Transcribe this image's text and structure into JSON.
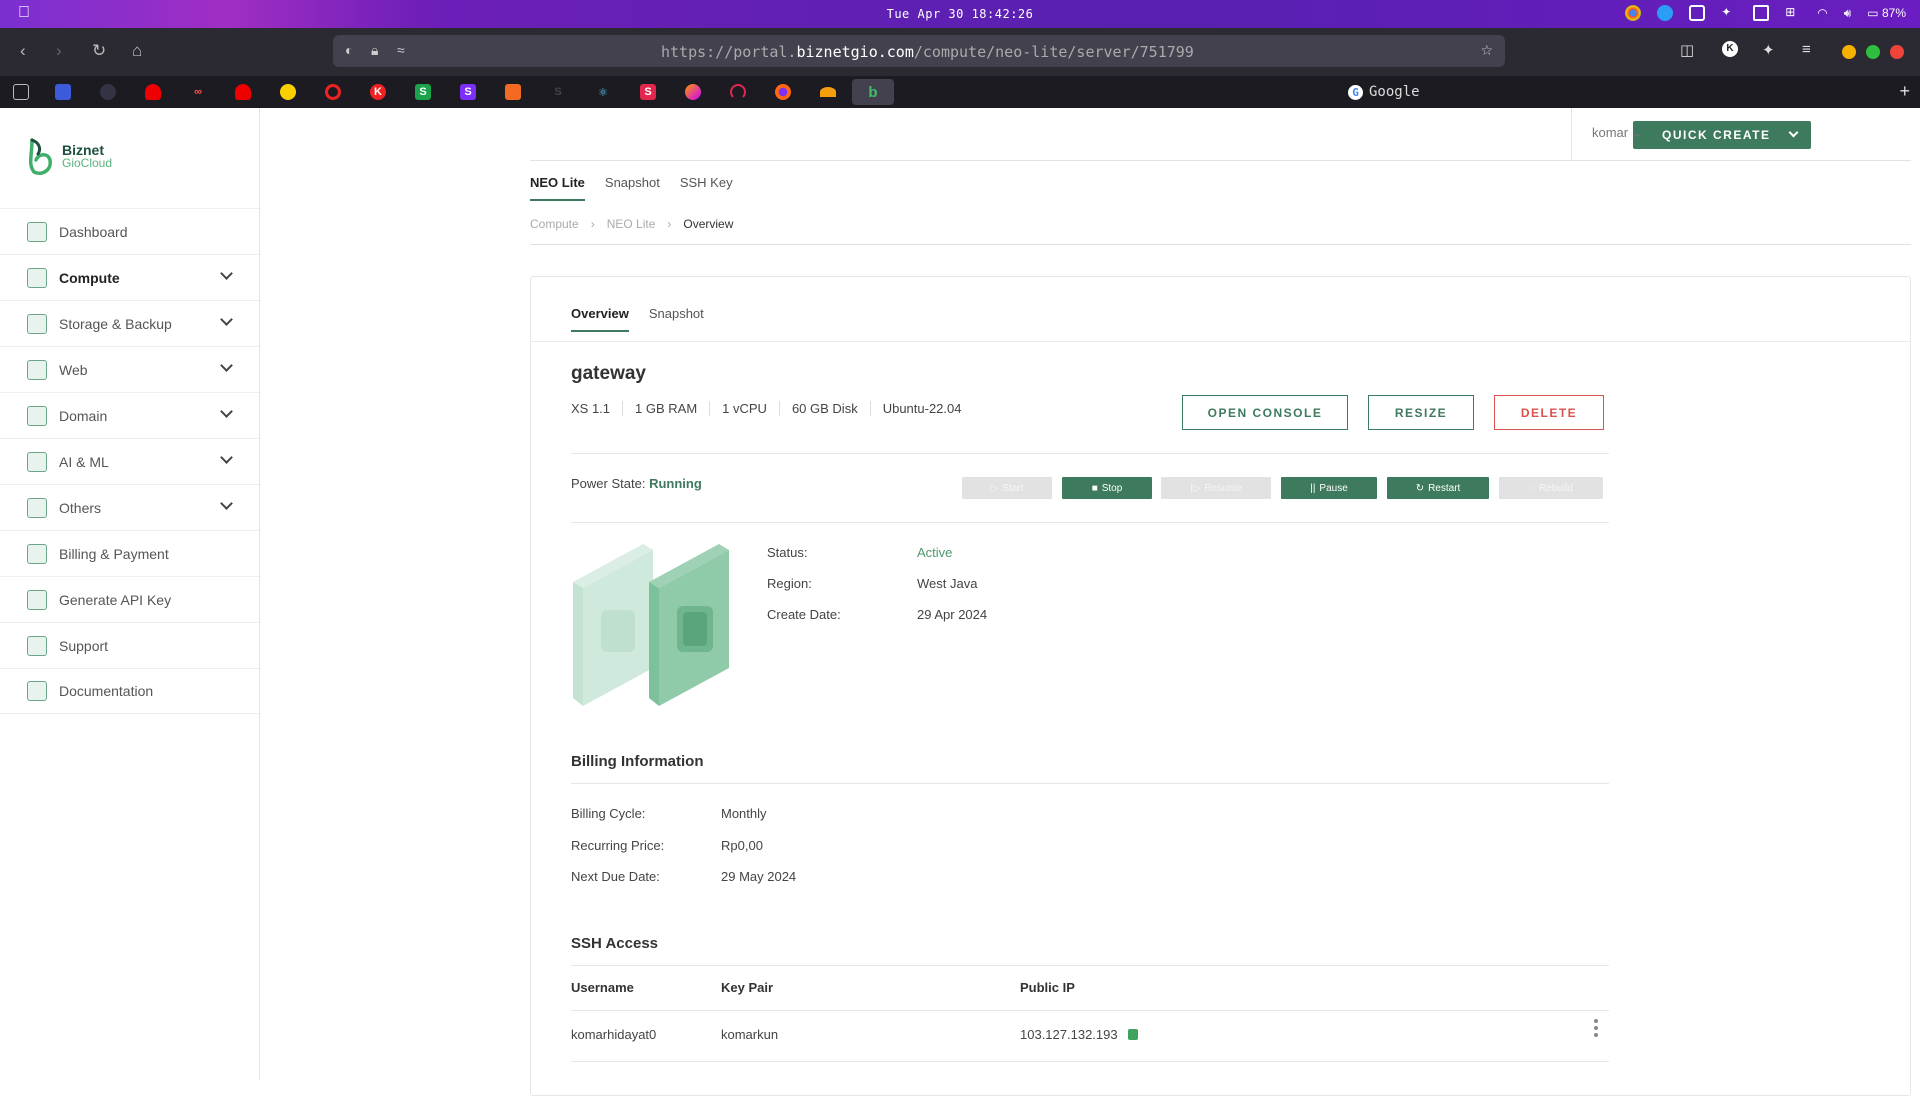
{
  "menubar": {
    "clock": "Tue Apr 30 18:42:26",
    "battery": "87%"
  },
  "browser": {
    "url_prefix": "https://portal.",
    "url_domain": "biznetgio.com",
    "url_path": "/compute/neo-lite/server/751799",
    "active_tab_title": "Google",
    "tab_favicons": [
      "archive",
      "blue-square",
      "grey-circle",
      "red-hat",
      "infinity",
      "red-hat",
      "yellow-duck",
      "red-ring",
      "red-logo",
      "green-s",
      "purple-s",
      "orange-cube",
      "dark-s",
      "atom",
      "red-s",
      "gradient",
      "red-arc",
      "firefox",
      "cloud",
      "biznet"
    ]
  },
  "brand": {
    "line1": "Biznet",
    "line2": "GioCloud"
  },
  "sidebar": {
    "items": [
      {
        "label": "Dashboard",
        "icon": "home-icon",
        "expandable": false
      },
      {
        "label": "Compute",
        "icon": "compute-icon",
        "expandable": true,
        "active": true
      },
      {
        "label": "Storage & Backup",
        "icon": "storage-icon",
        "expandable": true
      },
      {
        "label": "Web",
        "icon": "web-icon",
        "expandable": true
      },
      {
        "label": "Domain",
        "icon": "globe-icon",
        "expandable": true
      },
      {
        "label": "AI & ML",
        "icon": "ai-icon",
        "expandable": true
      },
      {
        "label": "Others",
        "icon": "others-icon",
        "expandable": true
      },
      {
        "label": "Billing & Payment",
        "icon": "card-icon",
        "expandable": false
      },
      {
        "label": "Generate API Key",
        "icon": "key-icon",
        "expandable": false
      },
      {
        "label": "Support",
        "icon": "support-icon",
        "expandable": false
      },
      {
        "label": "Documentation",
        "icon": "book-icon",
        "expandable": false
      }
    ]
  },
  "header": {
    "quick_create": "QUICK CREATE",
    "user": "komar"
  },
  "top_tabs": [
    "NEO Lite",
    "Snapshot",
    "SSH Key"
  ],
  "breadcrumb": [
    "Compute",
    "NEO Lite",
    "Overview"
  ],
  "card_tabs": [
    "Overview",
    "Snapshot"
  ],
  "server": {
    "name": "gateway",
    "specs": [
      "XS 1.1",
      "1 GB RAM",
      "1 vCPU",
      "60 GB Disk",
      "Ubuntu-22.04"
    ],
    "actions": {
      "console": "OPEN CONSOLE",
      "resize": "RESIZE",
      "delete": "DELETE"
    },
    "power_label": "Power State:",
    "power_state": "Running",
    "power_buttons": [
      {
        "label": "Start",
        "enabled": false
      },
      {
        "label": "Stop",
        "enabled": true
      },
      {
        "label": "Resume",
        "enabled": false
      },
      {
        "label": "Pause",
        "enabled": true
      },
      {
        "label": "Restart",
        "enabled": true
      },
      {
        "label": "Rebuild",
        "enabled": false
      }
    ],
    "details": [
      {
        "key": "Status:",
        "value": "Active"
      },
      {
        "key": "Region:",
        "value": "West Java"
      },
      {
        "key": "Create Date:",
        "value": "29 Apr 2024"
      }
    ]
  },
  "billing": {
    "title": "Billing Information",
    "rows": [
      {
        "key": "Billing Cycle:",
        "value": "Monthly"
      },
      {
        "key": "Recurring Price:",
        "value": "Rp0,00"
      },
      {
        "key": "Next Due Date:",
        "value": "29 May 2024"
      }
    ]
  },
  "ssh": {
    "title": "SSH Access",
    "columns": [
      "Username",
      "Key Pair",
      "Public IP"
    ],
    "row": {
      "username": "komarhidayat0",
      "key_pair": "komarkun",
      "public_ip": "103.127.132.193"
    }
  },
  "colors": {
    "accent": "#3e7a5d",
    "danger": "#d9534f",
    "status_green": "#4e9a6f"
  }
}
